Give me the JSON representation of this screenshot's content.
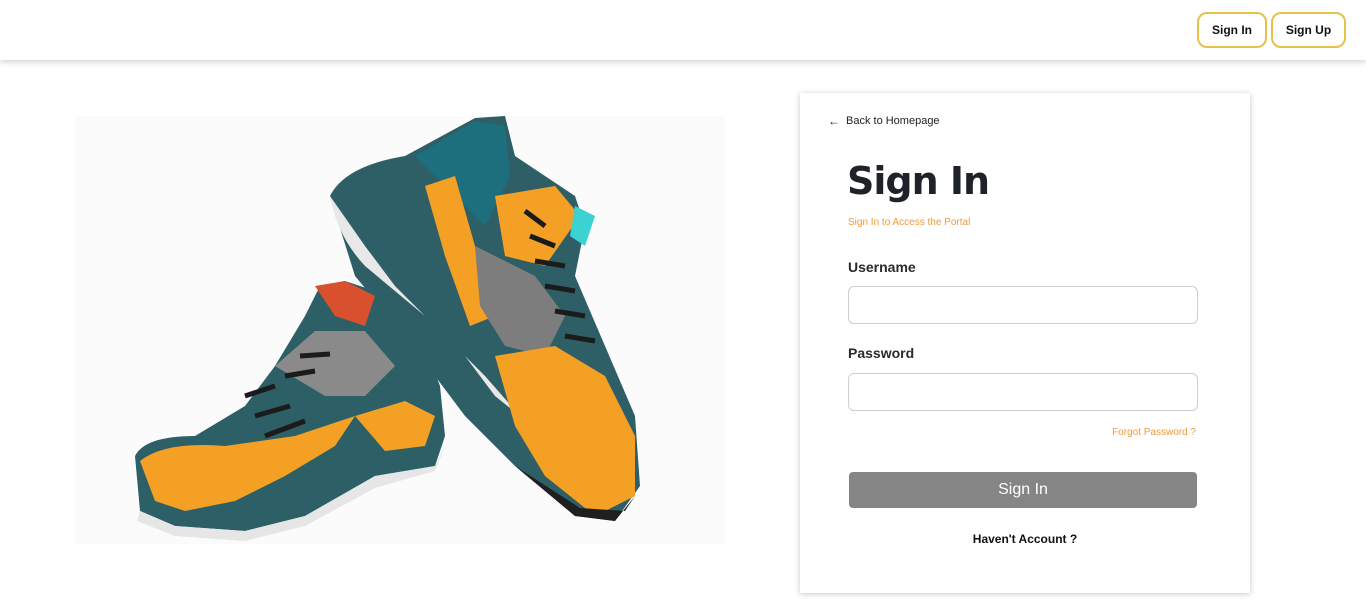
{
  "navbar": {
    "signin_label": "Sign In",
    "signup_label": "Sign Up",
    "accent_color": "#e8c14a"
  },
  "hero": {
    "image_icon": "sneakers-image"
  },
  "form": {
    "back_label": "Back to Homepage",
    "title": "Sign In",
    "subtitle": "Sign In to Access the Portal",
    "username_label": "Username",
    "username_value": "",
    "password_label": "Password",
    "password_value": "",
    "forgot_label": "Forgot Password ?",
    "submit_label": "Sign In",
    "no_account_label": "Haven't Account ?",
    "accent_color": "#f39a3a",
    "button_color": "#858585"
  }
}
